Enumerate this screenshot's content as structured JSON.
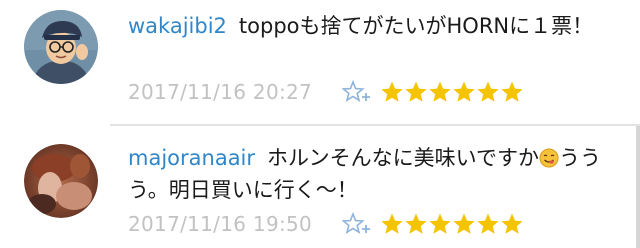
{
  "comments": [
    {
      "username": "wakajibi2",
      "text": "toppoも捨てがたいがHORNに１票！",
      "emoji": "",
      "text_after_emoji": "",
      "timestamp": "2017/11/16 20:27",
      "star_count": 6,
      "star_color": "#f4c400",
      "add_star_icon": "add-star-icon"
    },
    {
      "username": "majoranaair",
      "text": "ホルンそんなに美味いですか",
      "emoji": "savoring-face-emoji",
      "text_after_emoji": "ううう。明日買いに行く〜！",
      "timestamp": "2017/11/16 19:50",
      "star_count": 6,
      "star_color": "#f4c400",
      "add_star_icon": "add-star-icon"
    }
  ],
  "colors": {
    "username": "#2f86c8",
    "timestamp": "#c2c2c2",
    "star": "#f4c400",
    "add_star": "#8fb4dc"
  }
}
